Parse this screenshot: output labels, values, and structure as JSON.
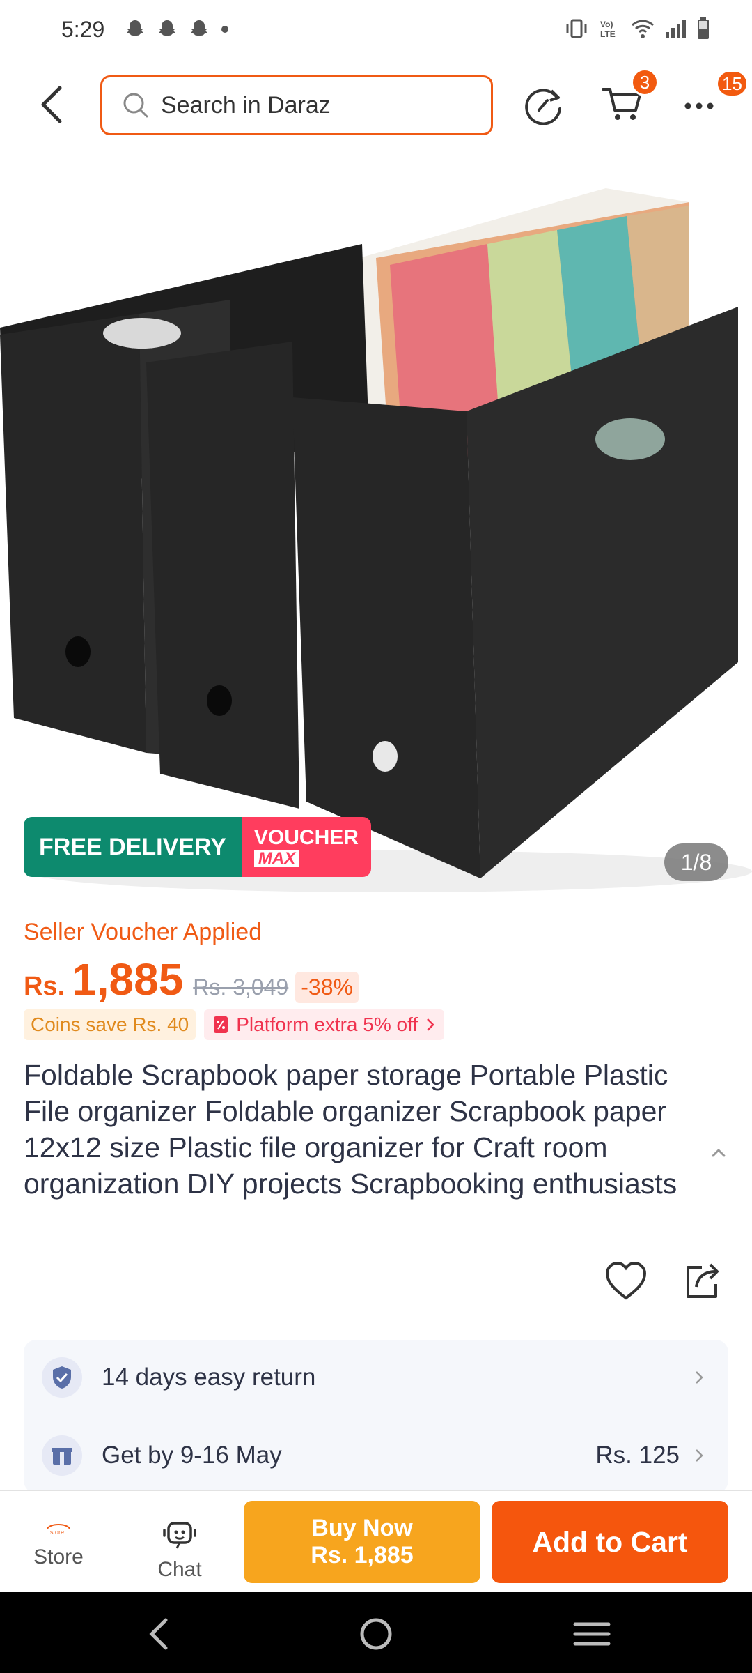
{
  "status_bar": {
    "time": "5:29",
    "left_icons": [
      "snapchat-icon",
      "snapchat-icon",
      "snapchat-icon",
      "dot-icon"
    ],
    "right_icons": [
      "vibrate-icon",
      "volte-icon",
      "wifi-icon",
      "signal-icon",
      "battery-icon"
    ]
  },
  "top_bar": {
    "search_placeholder": "Search in Daraz",
    "cart_count": "3",
    "more_count": "15"
  },
  "product_image": {
    "counter": "1/8",
    "promo_free_delivery": "FREE DELIVERY",
    "promo_voucher": "VOUCHER",
    "promo_max": "MAX"
  },
  "pricing": {
    "seller_voucher": "Seller Voucher Applied",
    "currency": "Rs.",
    "price": "1,885",
    "original_price": "Rs. 3,049",
    "discount": "-38%",
    "coins_save": "Coins save Rs. 40",
    "platform_extra": "Platform extra 5% off"
  },
  "product": {
    "title": "Foldable Scrapbook paper storage Portable Plastic File organizer Foldable organizer Scrapbook paper 12x12 size Plastic file organizer for Craft room organization DIY projects Scrapbooking enthusiasts"
  },
  "services": [
    {
      "icon": "shield-check-icon",
      "label": "14 days easy return",
      "value": ""
    },
    {
      "icon": "gift-box-icon",
      "label": "Get by 9-16 May",
      "value": "Rs. 125"
    }
  ],
  "bottom_bar": {
    "store_label": "Store",
    "chat_label": "Chat",
    "buy_now_label": "Buy Now",
    "buy_now_price": "Rs. 1,885",
    "add_to_cart_label": "Add to Cart"
  },
  "colors": {
    "accent": "#f5560d",
    "buy_now": "#f7a51e",
    "free_delivery": "#0d8a6e",
    "voucher": "#ff3d5e"
  }
}
